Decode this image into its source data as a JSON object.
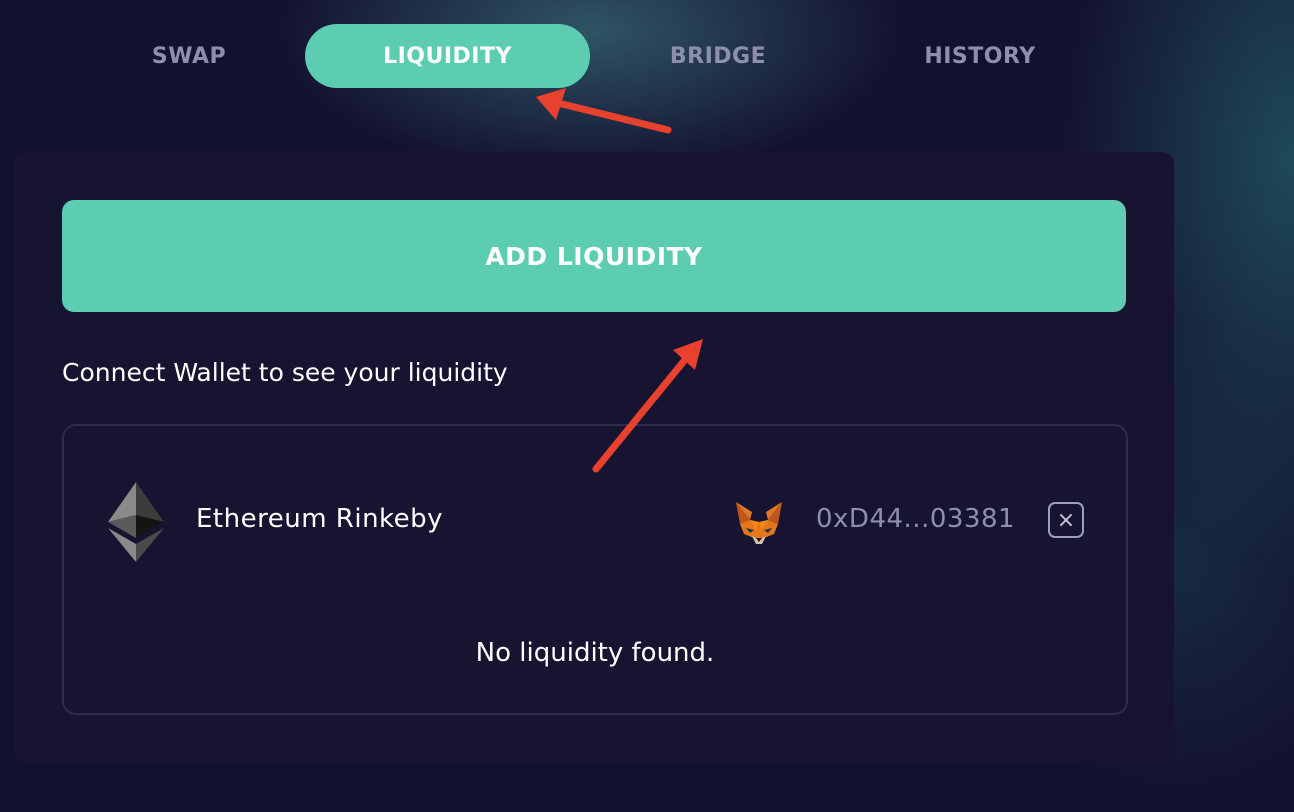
{
  "tabs": [
    {
      "label": "SWAP",
      "active": false
    },
    {
      "label": "LIQUIDITY",
      "active": true
    },
    {
      "label": "BRIDGE",
      "active": false
    },
    {
      "label": "HISTORY",
      "active": false
    }
  ],
  "card": {
    "add_liquidity_label": "ADD LIQUIDITY",
    "connect_text": "Connect Wallet to see your liquidity",
    "wallet": {
      "network_icon": "ethereum-icon",
      "network_name": "Ethereum Rinkeby",
      "wallet_icon": "metamask-fox-icon",
      "address": "0xD44...03381",
      "close_glyph": "×"
    },
    "empty_state": "No liquidity found."
  },
  "colors": {
    "accent": "#5ccdb1",
    "background": "#131131",
    "card": "#171431",
    "muted_text": "#8e8fae",
    "annotation_arrow": "#e8412e"
  }
}
